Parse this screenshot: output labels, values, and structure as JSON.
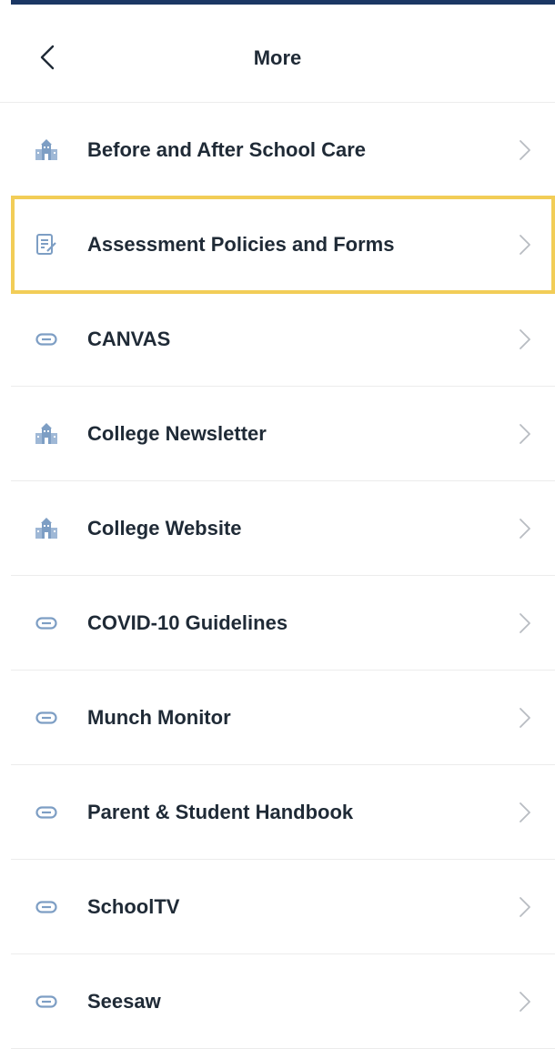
{
  "header": {
    "title": "More",
    "back_icon": "chevron-left-icon"
  },
  "colors": {
    "top_bar": "#1b3764",
    "highlight_border": "#f2cd57",
    "icon_blue": "#7d9ec4",
    "text": "#1f2a36",
    "chevron": "#b8bcc2"
  },
  "menu": {
    "items": [
      {
        "label": "Before and After School Care",
        "icon": "school-building-icon",
        "highlighted": false
      },
      {
        "label": "Assessment Policies and Forms",
        "icon": "document-edit-icon",
        "highlighted": true
      },
      {
        "label": "CANVAS",
        "icon": "link-icon",
        "highlighted": false
      },
      {
        "label": "College Newsletter",
        "icon": "school-building-icon",
        "highlighted": false
      },
      {
        "label": "College Website",
        "icon": "school-building-icon",
        "highlighted": false
      },
      {
        "label": "COVID-10 Guidelines",
        "icon": "link-icon",
        "highlighted": false
      },
      {
        "label": "Munch Monitor",
        "icon": "link-icon",
        "highlighted": false
      },
      {
        "label": "Parent & Student Handbook",
        "icon": "link-icon",
        "highlighted": false
      },
      {
        "label": "SchoolTV",
        "icon": "link-icon",
        "highlighted": false
      },
      {
        "label": "Seesaw",
        "icon": "link-icon",
        "highlighted": false
      }
    ]
  }
}
